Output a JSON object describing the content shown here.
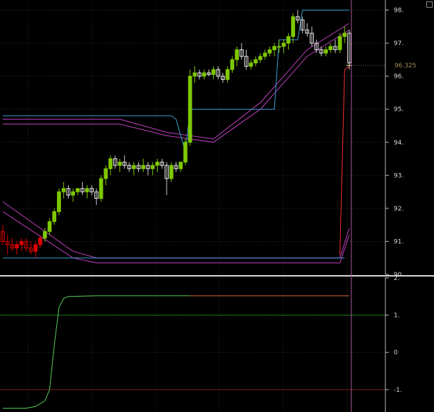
{
  "chart_data": [
    {
      "type": "candlestick",
      "price_label": "96.325",
      "current_price": 96.325,
      "ylim": [
        90,
        98.2
      ],
      "y_ticks": [
        {
          "value": 98,
          "label": "98."
        },
        {
          "value": 97,
          "label": "97."
        },
        {
          "value": 96,
          "label": "96."
        },
        {
          "value": 95,
          "label": "95."
        },
        {
          "value": 94,
          "label": "94."
        },
        {
          "value": 93,
          "label": "93."
        },
        {
          "value": 92,
          "label": "92."
        },
        {
          "value": 91,
          "label": "91."
        },
        {
          "value": 90,
          "label": "90."
        }
      ],
      "grid": true,
      "colors": {
        "up": "#7ec800",
        "down": "#f0f0f0",
        "bear_red": "#e00000",
        "upper_channel": "#3aa0d8",
        "bands": "#c040c0",
        "close_line": "#ff3030",
        "cursor": "#b05aa0",
        "grid": "#2a2a2a"
      },
      "candles": [
        [
          91.3,
          91.5,
          90.9,
          91.0
        ],
        [
          91.0,
          91.2,
          90.6,
          90.9
        ],
        [
          90.9,
          91.1,
          90.7,
          90.8
        ],
        [
          90.8,
          91.0,
          90.6,
          90.9
        ],
        [
          90.9,
          91.1,
          90.7,
          91.0
        ],
        [
          91.0,
          91.1,
          90.7,
          90.8
        ],
        [
          90.8,
          91.0,
          90.6,
          90.7
        ],
        [
          90.7,
          91.0,
          90.5,
          90.9
        ],
        [
          90.9,
          91.2,
          90.8,
          91.1
        ],
        [
          91.1,
          91.4,
          91.0,
          91.3
        ],
        [
          91.3,
          91.7,
          91.2,
          91.6
        ],
        [
          91.6,
          92.0,
          91.5,
          91.9
        ],
        [
          91.9,
          92.6,
          91.8,
          92.5
        ],
        [
          92.5,
          92.8,
          92.3,
          92.6
        ],
        [
          92.6,
          92.7,
          92.3,
          92.4
        ],
        [
          92.4,
          92.6,
          92.2,
          92.5
        ],
        [
          92.5,
          92.6,
          92.4,
          92.6
        ],
        [
          92.6,
          92.8,
          92.4,
          92.5
        ],
        [
          92.5,
          92.7,
          92.3,
          92.6
        ],
        [
          92.6,
          92.7,
          92.4,
          92.5
        ],
        [
          92.5,
          92.6,
          92.1,
          92.3
        ],
        [
          92.3,
          93.0,
          92.2,
          92.9
        ],
        [
          92.9,
          93.3,
          92.7,
          93.2
        ],
        [
          93.2,
          93.6,
          93.0,
          93.5
        ],
        [
          93.5,
          93.6,
          93.2,
          93.3
        ],
        [
          93.3,
          93.5,
          93.1,
          93.4
        ],
        [
          93.4,
          93.6,
          93.2,
          93.3
        ],
        [
          93.3,
          93.4,
          93.1,
          93.2
        ],
        [
          93.2,
          93.4,
          93.0,
          93.3
        ],
        [
          93.3,
          93.4,
          93.1,
          93.2
        ],
        [
          93.2,
          93.5,
          93.1,
          93.3
        ],
        [
          93.3,
          93.4,
          93.0,
          93.2
        ],
        [
          93.2,
          93.4,
          93.0,
          93.3
        ],
        [
          93.3,
          93.5,
          93.1,
          93.4
        ],
        [
          93.4,
          93.5,
          93.2,
          93.3
        ],
        [
          93.3,
          93.4,
          92.4,
          92.9
        ],
        [
          92.9,
          93.4,
          92.8,
          93.3
        ],
        [
          93.3,
          93.4,
          93.1,
          93.2
        ],
        [
          93.2,
          93.4,
          93.1,
          93.4
        ],
        [
          93.4,
          94.1,
          93.3,
          94.0
        ],
        [
          94.0,
          96.2,
          93.9,
          96.0
        ],
        [
          96.0,
          96.3,
          95.8,
          96.1
        ],
        [
          96.1,
          96.2,
          95.9,
          96.0
        ],
        [
          96.0,
          96.2,
          95.9,
          96.1
        ],
        [
          96.1,
          96.2,
          96.0,
          96.05
        ],
        [
          96.05,
          96.3,
          95.9,
          96.2
        ],
        [
          96.2,
          96.3,
          95.9,
          96.0
        ],
        [
          96.0,
          96.1,
          95.8,
          95.9
        ],
        [
          95.9,
          96.3,
          95.8,
          96.2
        ],
        [
          96.2,
          96.6,
          96.1,
          96.5
        ],
        [
          96.5,
          96.9,
          96.3,
          96.8
        ],
        [
          96.8,
          97.0,
          96.5,
          96.6
        ],
        [
          96.6,
          96.8,
          96.2,
          96.3
        ],
        [
          96.3,
          96.5,
          96.2,
          96.4
        ],
        [
          96.4,
          96.6,
          96.3,
          96.5
        ],
        [
          96.5,
          96.7,
          96.4,
          96.6
        ],
        [
          96.6,
          96.8,
          96.5,
          96.7
        ],
        [
          96.7,
          96.9,
          96.6,
          96.8
        ],
        [
          96.8,
          97.0,
          96.6,
          96.9
        ],
        [
          96.9,
          97.1,
          96.7,
          96.9
        ],
        [
          96.9,
          97.1,
          96.7,
          97.0
        ],
        [
          97.0,
          97.3,
          96.8,
          97.2
        ],
        [
          97.2,
          97.9,
          97.0,
          97.8
        ],
        [
          97.8,
          98.0,
          97.6,
          97.7
        ],
        [
          97.7,
          97.8,
          97.3,
          97.4
        ],
        [
          97.4,
          97.6,
          97.2,
          97.3
        ],
        [
          97.3,
          97.5,
          96.9,
          97.0
        ],
        [
          97.0,
          97.1,
          96.7,
          96.8
        ],
        [
          96.8,
          96.9,
          96.6,
          96.7
        ],
        [
          96.7,
          96.9,
          96.6,
          96.8
        ],
        [
          96.8,
          97.0,
          96.7,
          96.9
        ],
        [
          96.9,
          97.1,
          96.7,
          96.8
        ],
        [
          96.8,
          97.3,
          96.7,
          97.2
        ],
        [
          97.2,
          97.5,
          97.0,
          97.3
        ],
        [
          97.3,
          97.4,
          96.2,
          96.4
        ]
      ],
      "upper_channel_points": [
        [
          0,
          94.8
        ],
        [
          36,
          94.8
        ],
        [
          37,
          94.7
        ],
        [
          39,
          93.7
        ],
        [
          40,
          95.0
        ],
        [
          58,
          95.0
        ],
        [
          59,
          97.1
        ],
        [
          63,
          97.1
        ],
        [
          64,
          98.0
        ],
        [
          74,
          98.0
        ]
      ],
      "lower_channel_level": 90.5,
      "band_series": [
        {
          "name": "band_upper_1",
          "points": [
            [
              0,
              94.7
            ],
            [
              25,
              94.7
            ],
            [
              35,
              94.3
            ],
            [
              45,
              94.1
            ],
            [
              55,
              95.2
            ],
            [
              65,
              96.8
            ],
            [
              74,
              97.6
            ]
          ]
        },
        {
          "name": "band_upper_2",
          "points": [
            [
              0,
              94.55
            ],
            [
              25,
              94.55
            ],
            [
              35,
              94.2
            ],
            [
              45,
              94.0
            ],
            [
              55,
              95.0
            ],
            [
              65,
              96.6
            ],
            [
              74,
              97.4
            ]
          ]
        },
        {
          "name": "band_lower_1",
          "points": [
            [
              0,
              92.2
            ],
            [
              15,
              90.7
            ],
            [
              20,
              90.5
            ],
            [
              40,
              90.5
            ],
            [
              60,
              90.5
            ],
            [
              72,
              90.5
            ],
            [
              74,
              91.4
            ]
          ]
        },
        {
          "name": "band_lower_2",
          "points": [
            [
              0,
              91.9
            ],
            [
              15,
              90.5
            ],
            [
              20,
              90.35
            ],
            [
              40,
              90.35
            ],
            [
              60,
              90.35
            ],
            [
              72,
              90.35
            ],
            [
              74,
              91.2
            ]
          ]
        }
      ],
      "close_line_points": [
        [
          72,
          90.6
        ],
        [
          73,
          96.2
        ],
        [
          74,
          96.3
        ]
      ]
    },
    {
      "type": "line",
      "ylim": [
        -1.6,
        2.0
      ],
      "y_ticks": [
        {
          "value": 2,
          "label": "2."
        },
        {
          "value": 1,
          "label": "1."
        },
        {
          "value": 0,
          "label": "0"
        },
        {
          "value": -1,
          "label": "-1."
        }
      ],
      "reference_levels": [
        {
          "value": 1,
          "color": "#1e7a1e"
        },
        {
          "value": -1,
          "color": "#7a1e1e"
        }
      ],
      "series": [
        {
          "color": "#56d056",
          "red_tail_color": "#d03030",
          "points": [
            [
              0,
              -1.5
            ],
            [
              5,
              -1.5
            ],
            [
              7,
              -1.45
            ],
            [
              9,
              -1.3
            ],
            [
              10,
              -1.0
            ],
            [
              11,
              0.2
            ],
            [
              12,
              1.2
            ],
            [
              13,
              1.45
            ],
            [
              14,
              1.5
            ],
            [
              20,
              1.52
            ],
            [
              60,
              1.52
            ],
            [
              74,
              1.52
            ]
          ]
        }
      ]
    }
  ]
}
